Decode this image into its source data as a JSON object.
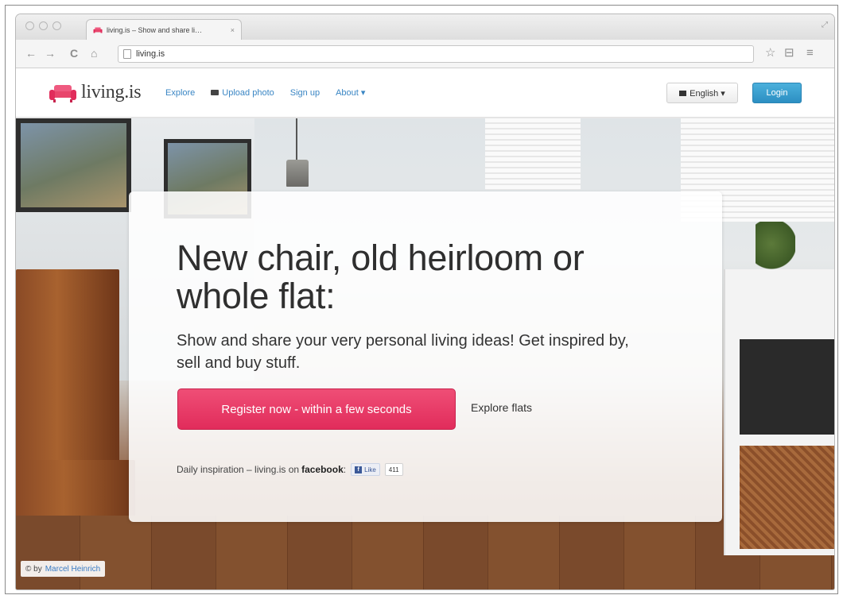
{
  "browser": {
    "tab_title": "living.is – Show and share li…",
    "tab_close": "×",
    "url": "living.is",
    "nav": {
      "back": "←",
      "forward": "→",
      "reload": "C",
      "home": "⌂"
    },
    "tools": {
      "star": "☆",
      "extension": "⊟",
      "menu": "≡"
    },
    "resize_glyph": "⤢"
  },
  "site": {
    "logo_text": "living.is",
    "nav": {
      "explore": "Explore",
      "upload": "Upload photo",
      "signup": "Sign up",
      "about": "About ▾"
    },
    "language_label": "English ▾",
    "login_label": "Login"
  },
  "hero": {
    "headline": "New chair, old heirloom or whole flat:",
    "subline": "Show and share your very personal living ideas! Get inspired by, sell and buy stuff.",
    "register_label": "Register now - within a few seconds",
    "explore_label": "Explore flats",
    "daily_prefix": "Daily inspiration – living.is on",
    "daily_brand": "facebook",
    "daily_colon": ":",
    "fb_like_label": "Like",
    "fb_like_count": "411"
  },
  "photo_credit": {
    "prefix": "© by",
    "author": "Marcel Heinrich"
  },
  "colors": {
    "brand_pink": "#e12c5b",
    "login_blue": "#2c8fc2",
    "link_blue": "#3a86c4"
  }
}
